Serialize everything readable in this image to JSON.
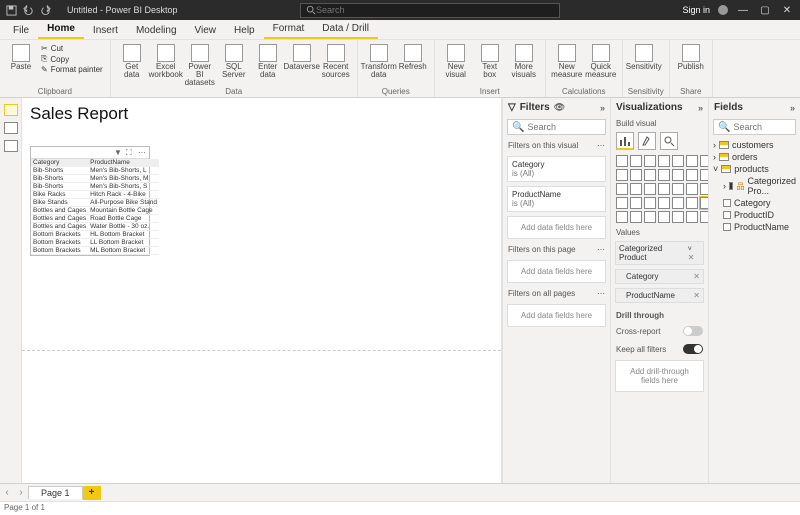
{
  "titlebar": {
    "title": "Untitled - Power BI Desktop",
    "search_placeholder": "Search",
    "sign_in": "Sign in"
  },
  "tabs": [
    "File",
    "Home",
    "Insert",
    "Modeling",
    "View",
    "Help",
    "Format",
    "Data / Drill"
  ],
  "ribbon": {
    "clipboard": {
      "cut": "Cut",
      "copy": "Copy",
      "fmt": "Format painter",
      "paste": "Paste",
      "label": "Clipboard"
    },
    "data": {
      "items": [
        "Get data",
        "Excel workbook",
        "Power BI datasets",
        "SQL Server",
        "Enter data",
        "Dataverse",
        "Recent sources"
      ],
      "label": "Data"
    },
    "queries": {
      "items": [
        "Transform data",
        "Refresh"
      ],
      "label": "Queries"
    },
    "insert": {
      "items": [
        "New visual",
        "Text box",
        "More visuals"
      ],
      "label": "Insert"
    },
    "calc": {
      "items": [
        "New measure",
        "Quick measure"
      ],
      "label": "Calculations"
    },
    "sens": {
      "items": [
        "Sensitivity"
      ],
      "label": "Sensitivity"
    },
    "share": {
      "items": [
        "Publish"
      ],
      "label": "Share"
    }
  },
  "report": {
    "title": "Sales Report"
  },
  "table": {
    "cols": [
      "Category",
      "ProductName"
    ],
    "rows": [
      [
        "Bib-Shorts",
        "Men's Bib-Shorts, L"
      ],
      [
        "Bib-Shorts",
        "Men's Bib-Shorts, M"
      ],
      [
        "Bib-Shorts",
        "Men's Bib-Shorts, S"
      ],
      [
        "Bike Racks",
        "Hitch Rack - 4-Bike"
      ],
      [
        "Bike Stands",
        "All-Purpose Bike Stand"
      ],
      [
        "Bottles and Cages",
        "Mountain Bottle Cage"
      ],
      [
        "Bottles and Cages",
        "Road Bottle Cage"
      ],
      [
        "Bottles and Cages",
        "Water Bottle - 30 oz."
      ],
      [
        "Bottom Brackets",
        "HL Bottom Bracket"
      ],
      [
        "Bottom Brackets",
        "LL Bottom Bracket"
      ],
      [
        "Bottom Brackets",
        "ML Bottom Bracket"
      ]
    ]
  },
  "filters": {
    "title": "Filters",
    "search": "Search",
    "on_visual": "Filters on this visual",
    "f1": {
      "name": "Category",
      "val": "is (All)"
    },
    "f2": {
      "name": "ProductName",
      "val": "is (All)"
    },
    "add": "Add data fields here",
    "on_page": "Filters on this page",
    "on_all": "Filters on all pages"
  },
  "viz": {
    "title": "Visualizations",
    "sub": "Build visual",
    "values": "Values",
    "field1": "Categorized Product",
    "sub1": "Category",
    "sub2": "ProductName",
    "drill": "Drill through",
    "cross": "Cross-report",
    "keep": "Keep all filters",
    "drilladd": "Add drill-through fields here"
  },
  "fields": {
    "title": "Fields",
    "search": "Search",
    "t1": "customers",
    "t2": "orders",
    "t3": "products",
    "c1": "Categorized Pro...",
    "c2": "Category",
    "c3": "ProductID",
    "c4": "ProductName"
  },
  "page": {
    "tab": "Page 1",
    "status": "Page 1 of 1"
  }
}
